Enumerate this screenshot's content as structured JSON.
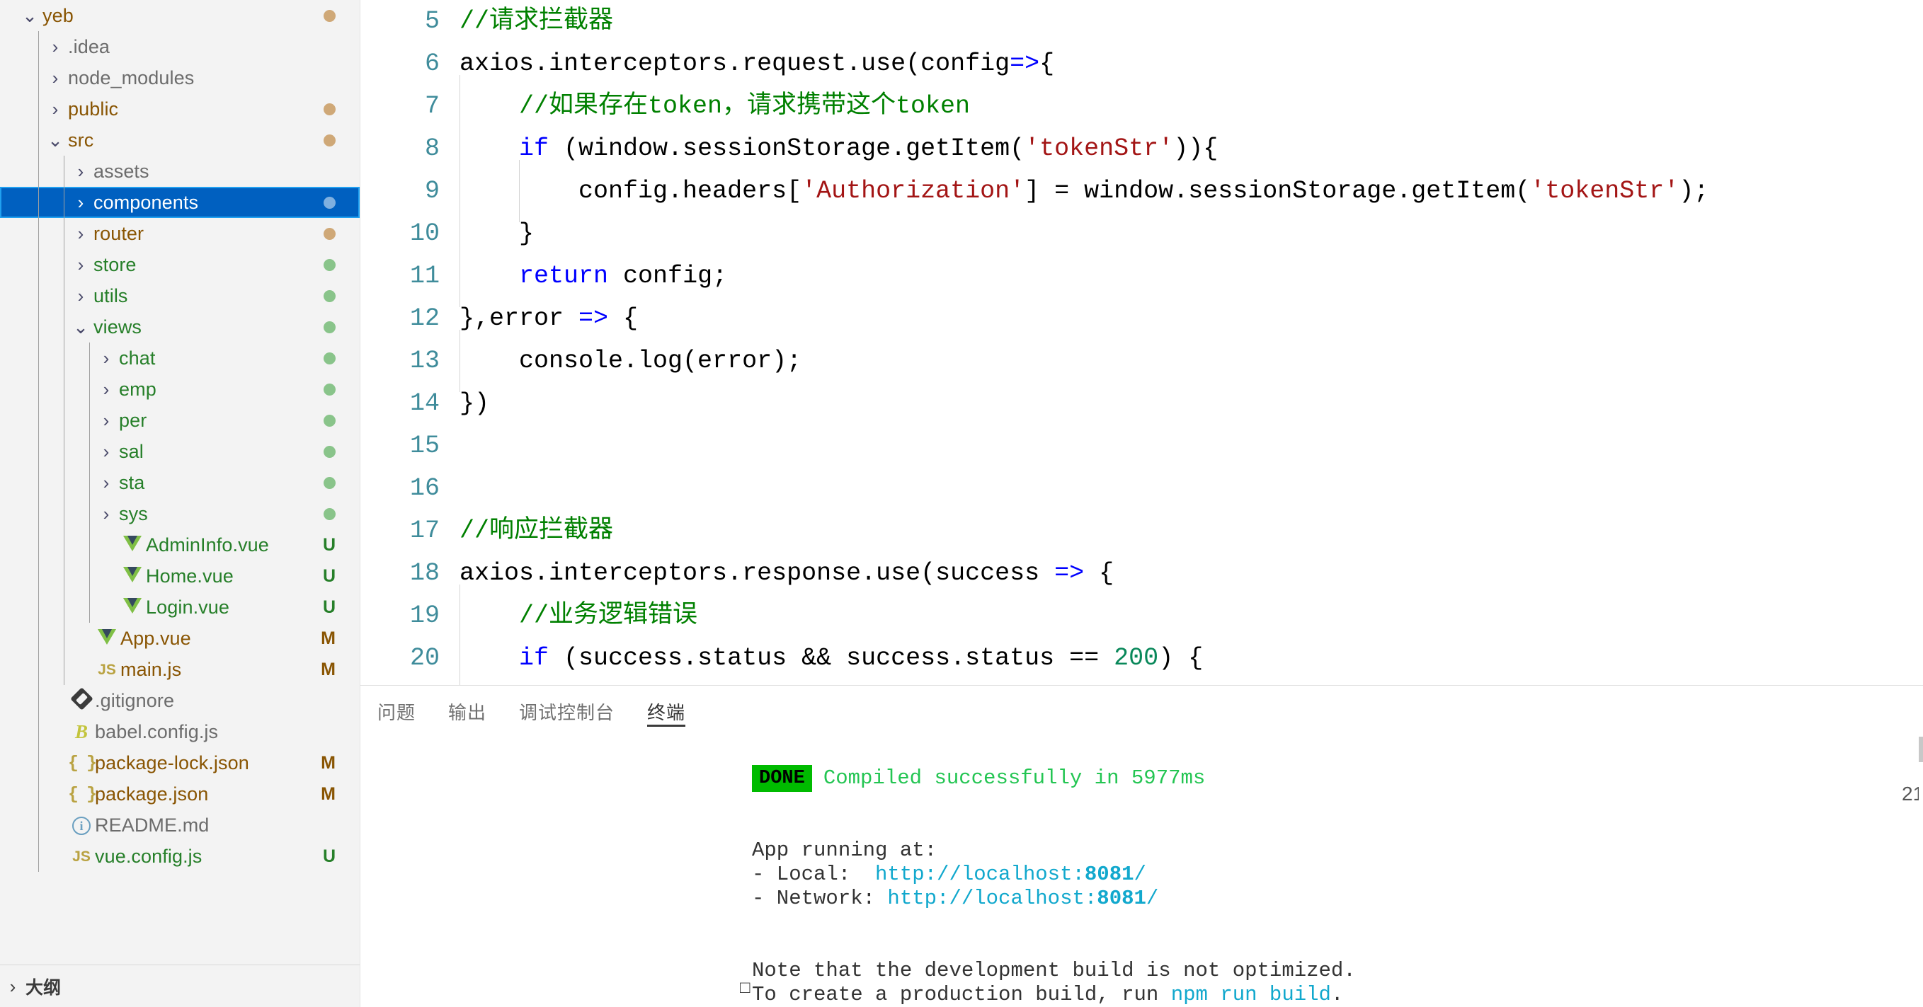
{
  "sidebar": {
    "outline_label": "大纲",
    "tree": [
      {
        "depth": 0,
        "twist": "chevron-down-icon",
        "icon": "none",
        "label": "yeb",
        "color": "amber",
        "dot": "amber",
        "badge": ""
      },
      {
        "depth": 1,
        "twist": "chevron-right-icon",
        "icon": "none",
        "label": ".idea",
        "color": "gray",
        "dot": "",
        "badge": ""
      },
      {
        "depth": 1,
        "twist": "chevron-right-icon",
        "icon": "none",
        "label": "node_modules",
        "color": "gray",
        "dot": "",
        "badge": ""
      },
      {
        "depth": 1,
        "twist": "chevron-right-icon",
        "icon": "none",
        "label": "public",
        "color": "amber",
        "dot": "amber",
        "badge": ""
      },
      {
        "depth": 1,
        "twist": "chevron-down-icon",
        "icon": "none",
        "label": "src",
        "color": "amber",
        "dot": "amber",
        "badge": ""
      },
      {
        "depth": 2,
        "twist": "chevron-right-icon",
        "icon": "none",
        "label": "assets",
        "color": "gray",
        "dot": "",
        "badge": ""
      },
      {
        "depth": 2,
        "twist": "chevron-right-icon",
        "icon": "none",
        "label": "components",
        "color": "white",
        "dot": "blue",
        "badge": "",
        "selected": true
      },
      {
        "depth": 2,
        "twist": "chevron-right-icon",
        "icon": "none",
        "label": "router",
        "color": "amber",
        "dot": "amber",
        "badge": ""
      },
      {
        "depth": 2,
        "twist": "chevron-right-icon",
        "icon": "none",
        "label": "store",
        "color": "green",
        "dot": "green",
        "badge": ""
      },
      {
        "depth": 2,
        "twist": "chevron-right-icon",
        "icon": "none",
        "label": "utils",
        "color": "green",
        "dot": "green",
        "badge": ""
      },
      {
        "depth": 2,
        "twist": "chevron-down-icon",
        "icon": "none",
        "label": "views",
        "color": "green",
        "dot": "green",
        "badge": ""
      },
      {
        "depth": 3,
        "twist": "chevron-right-icon",
        "icon": "none",
        "label": "chat",
        "color": "green",
        "dot": "green",
        "badge": ""
      },
      {
        "depth": 3,
        "twist": "chevron-right-icon",
        "icon": "none",
        "label": "emp",
        "color": "green",
        "dot": "green",
        "badge": ""
      },
      {
        "depth": 3,
        "twist": "chevron-right-icon",
        "icon": "none",
        "label": "per",
        "color": "green",
        "dot": "green",
        "badge": ""
      },
      {
        "depth": 3,
        "twist": "chevron-right-icon",
        "icon": "none",
        "label": "sal",
        "color": "green",
        "dot": "green",
        "badge": ""
      },
      {
        "depth": 3,
        "twist": "chevron-right-icon",
        "icon": "none",
        "label": "sta",
        "color": "green",
        "dot": "green",
        "badge": ""
      },
      {
        "depth": 3,
        "twist": "chevron-right-icon",
        "icon": "none",
        "label": "sys",
        "color": "green",
        "dot": "green",
        "badge": ""
      },
      {
        "depth": 3,
        "twist": "none",
        "icon": "vue-icon",
        "label": "AdminInfo.vue",
        "color": "green",
        "dot": "",
        "badge": "U"
      },
      {
        "depth": 3,
        "twist": "none",
        "icon": "vue-icon",
        "label": "Home.vue",
        "color": "green",
        "dot": "",
        "badge": "U"
      },
      {
        "depth": 3,
        "twist": "none",
        "icon": "vue-icon",
        "label": "Login.vue",
        "color": "green",
        "dot": "",
        "badge": "U"
      },
      {
        "depth": 2,
        "twist": "none",
        "icon": "vue-icon",
        "label": "App.vue",
        "color": "amber",
        "dot": "",
        "badge": "M"
      },
      {
        "depth": 2,
        "twist": "none",
        "icon": "js-icon",
        "label": "main.js",
        "color": "amber",
        "dot": "",
        "badge": "M"
      },
      {
        "depth": 1,
        "twist": "none",
        "icon": "git-icon",
        "label": ".gitignore",
        "color": "gray",
        "dot": "",
        "badge": ""
      },
      {
        "depth": 1,
        "twist": "none",
        "icon": "babel-icon",
        "label": "babel.config.js",
        "color": "gray",
        "dot": "",
        "badge": ""
      },
      {
        "depth": 1,
        "twist": "none",
        "icon": "json-icon",
        "label": "package-lock.json",
        "color": "amber",
        "dot": "",
        "badge": "M"
      },
      {
        "depth": 1,
        "twist": "none",
        "icon": "json-icon",
        "label": "package.json",
        "color": "amber",
        "dot": "",
        "badge": "M"
      },
      {
        "depth": 1,
        "twist": "none",
        "icon": "markdown-icon",
        "label": "README.md",
        "color": "gray",
        "dot": "",
        "badge": ""
      },
      {
        "depth": 1,
        "twist": "none",
        "icon": "js-icon",
        "label": "vue.config.js",
        "color": "green",
        "dot": "",
        "badge": "U"
      }
    ]
  },
  "editor": {
    "lines": [
      {
        "num": "5",
        "indent": 0,
        "tokens": [
          {
            "t": "cmt",
            "v": "//请求拦截器"
          }
        ]
      },
      {
        "num": "6",
        "indent": 0,
        "tokens": [
          {
            "t": "plain",
            "v": "axios.interceptors.request.use(config"
          },
          {
            "t": "op",
            "v": "=>"
          },
          {
            "t": "plain",
            "v": "{"
          }
        ]
      },
      {
        "num": "7",
        "indent": 1,
        "tokens": [
          {
            "t": "cmt",
            "v": "//如果存在token，请求携带这个token"
          }
        ]
      },
      {
        "num": "8",
        "indent": 1,
        "tokens": [
          {
            "t": "kw",
            "v": "if"
          },
          {
            "t": "plain",
            "v": " (window.sessionStorage.getItem("
          },
          {
            "t": "str",
            "v": "'tokenStr'"
          },
          {
            "t": "plain",
            "v": ")){"
          }
        ]
      },
      {
        "num": "9",
        "indent": 2,
        "tokens": [
          {
            "t": "plain",
            "v": "config.headers["
          },
          {
            "t": "str",
            "v": "'Authorization'"
          },
          {
            "t": "plain",
            "v": "] = window.sessionStorage.getItem("
          },
          {
            "t": "str",
            "v": "'tokenStr'"
          },
          {
            "t": "plain",
            "v": ");"
          }
        ]
      },
      {
        "num": "10",
        "indent": 1,
        "tokens": [
          {
            "t": "plain",
            "v": "}"
          }
        ]
      },
      {
        "num": "11",
        "indent": 1,
        "tokens": [
          {
            "t": "kw",
            "v": "return"
          },
          {
            "t": "plain",
            "v": " config;"
          }
        ]
      },
      {
        "num": "12",
        "indent": 0,
        "tokens": [
          {
            "t": "plain",
            "v": "},error "
          },
          {
            "t": "op",
            "v": "=>"
          },
          {
            "t": "plain",
            "v": " {"
          }
        ]
      },
      {
        "num": "13",
        "indent": 1,
        "tokens": [
          {
            "t": "plain",
            "v": "console.log(error);"
          }
        ]
      },
      {
        "num": "14",
        "indent": 0,
        "tokens": [
          {
            "t": "plain",
            "v": "})"
          }
        ]
      },
      {
        "num": "15",
        "indent": 0,
        "tokens": []
      },
      {
        "num": "16",
        "indent": 0,
        "tokens": []
      },
      {
        "num": "17",
        "indent": 0,
        "tokens": [
          {
            "t": "cmt",
            "v": "//响应拦截器"
          }
        ]
      },
      {
        "num": "18",
        "indent": 0,
        "tokens": [
          {
            "t": "plain",
            "v": "axios.interceptors.response.use(success "
          },
          {
            "t": "op",
            "v": "=>"
          },
          {
            "t": "plain",
            "v": " {"
          }
        ]
      },
      {
        "num": "19",
        "indent": 1,
        "tokens": [
          {
            "t": "cmt",
            "v": "//业务逻辑错误"
          }
        ]
      },
      {
        "num": "20",
        "indent": 1,
        "tokens": [
          {
            "t": "kw",
            "v": "if"
          },
          {
            "t": "plain",
            "v": " (success.status && success.status == "
          },
          {
            "t": "num",
            "v": "200"
          },
          {
            "t": "plain",
            "v": ") {"
          }
        ]
      }
    ]
  },
  "panel": {
    "tabs": [
      {
        "label": "问题",
        "active": false
      },
      {
        "label": "输出",
        "active": false
      },
      {
        "label": "调试控制台",
        "active": false
      },
      {
        "label": "终端",
        "active": true
      }
    ],
    "clock": "21",
    "terminal": {
      "done_badge": "DONE",
      "done_message": "Compiled successfully in 5977ms",
      "app_running_label": "App running at:",
      "local_label": "- Local:  ",
      "local_url_prefix": "http://localhost:",
      "local_port": "8081",
      "local_url_suffix": "/",
      "network_label": "- Network:",
      "network_url_prefix": " http://localhost:",
      "network_port": "8081",
      "network_url_suffix": "/",
      "note_line": "Note that the development build is not optimized.",
      "prod_line_prefix": "To create a production build, run ",
      "prod_command": "npm run build",
      "prod_line_suffix": "."
    }
  },
  "colors": {
    "selection": "#0060c0",
    "selection_border": "#20a0f0",
    "sidebar_bg": "#f3f3f3",
    "comment": "#008000",
    "keyword": "#0000ff",
    "string": "#a31515",
    "number": "#09885a",
    "terminal_green": "#1ed760",
    "terminal_cyan": "#11a8cd",
    "done_badge_bg": "#00bb00"
  }
}
